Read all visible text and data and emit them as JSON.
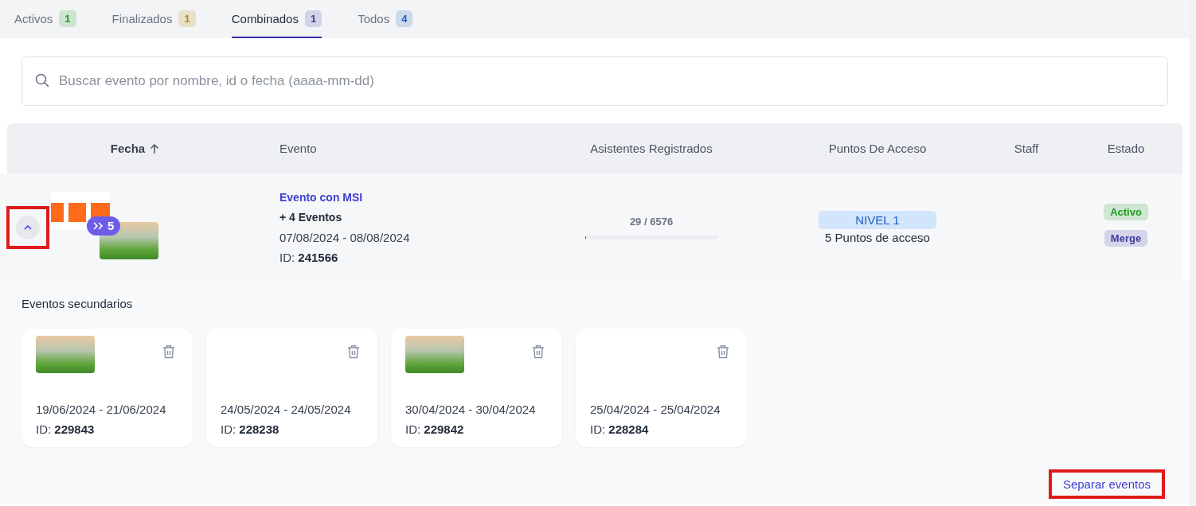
{
  "tabs": [
    {
      "label": "Activos",
      "count": "1",
      "color": "#1f9a1f",
      "selected": false
    },
    {
      "label": "Finalizados",
      "count": "1",
      "color": "#b8860b",
      "selected": false
    },
    {
      "label": "Combinados",
      "count": "1",
      "color": "#3f3f9e",
      "selected": true
    },
    {
      "label": "Todos",
      "count": "4",
      "color": "#1d5fbf",
      "selected": false
    }
  ],
  "search": {
    "placeholder": "Buscar evento por nombre, id o fecha (aaaa-mm-dd)"
  },
  "table": {
    "columns": [
      {
        "label": "Fecha",
        "sorted": true
      },
      {
        "label": "Evento",
        "sorted": false
      },
      {
        "label": "Asistentes Registrados",
        "sorted": false
      },
      {
        "label": "Puntos De Acceso",
        "sorted": false
      },
      {
        "label": "Staff",
        "sorted": false
      },
      {
        "label": "Estado",
        "sorted": false
      }
    ],
    "rows": [
      {
        "expanded": true,
        "highlighted": true,
        "merge_count": "5",
        "title": "Evento con MSI",
        "subtitle": "+ 4 Eventos",
        "dates": "07/08/2024 - 08/08/2024",
        "id_label": "ID:",
        "id": "241566",
        "attendees": "29 / 6576",
        "level": 0.0044,
        "access_level": "NIVEL 1",
        "access_points": "5 Puntos de acceso",
        "statuses": [
          {
            "label": "Activo",
            "color": "#1f9a1f"
          },
          {
            "label": "Merge",
            "color": "#3f3f9e"
          }
        ]
      }
    ]
  },
  "secondary": {
    "title": "Eventos secundarios",
    "cards": [
      {
        "kind": "image",
        "dates": "19/06/2024 - 21/06/2024",
        "id_label": "ID:",
        "id": "229843"
      },
      {
        "kind": "blank",
        "dates": "24/05/2024 - 24/05/2024",
        "id_label": "ID:",
        "id": "228238"
      },
      {
        "kind": "image",
        "dates": "30/04/2024 - 30/04/2024",
        "id_label": "ID:",
        "id": "229842"
      },
      {
        "kind": "blank",
        "dates": "25/04/2024 - 25/04/2024",
        "id_label": "ID:",
        "id": "228284"
      }
    ]
  },
  "separate_button": {
    "label": "Separar eventos",
    "highlighted": true
  }
}
